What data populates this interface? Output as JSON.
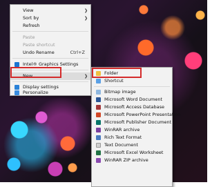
{
  "context_menu": {
    "items": [
      {
        "label": "View"
      },
      {
        "label": "Sort by"
      },
      {
        "label": "Refresh"
      },
      {
        "label": "Paste"
      },
      {
        "label": "Paste shortcut"
      },
      {
        "label": "Undo Rename",
        "shortcut": "Ctrl+Z"
      },
      {
        "label": "Intel® Graphics Settings"
      },
      {
        "label": "New"
      },
      {
        "label": "Display settings"
      },
      {
        "label": "Personalize"
      }
    ]
  },
  "new_submenu": {
    "items": [
      {
        "label": "Folder"
      },
      {
        "label": "Shortcut"
      },
      {
        "label": "Bitmap image"
      },
      {
        "label": "Microsoft Word Document"
      },
      {
        "label": "Microsoft Access Database"
      },
      {
        "label": "Microsoft PowerPoint Presentation"
      },
      {
        "label": "Microsoft Publisher Document"
      },
      {
        "label": "WinRAR archive"
      },
      {
        "label": "Rich Text Format"
      },
      {
        "label": "Text Document"
      },
      {
        "label": "Microsoft Excel Worksheet"
      },
      {
        "label": "WinRAR ZIP archive"
      }
    ]
  },
  "colors": {
    "highlight_border": "#d42a2a",
    "menu_bg": "#f2f2f2",
    "intel_icon": "#1a76d2",
    "folder_icon": "#f0c040",
    "word_icon": "#2b5797",
    "access_icon": "#a4373a",
    "powerpoint_icon": "#d24726",
    "publisher_icon": "#077568",
    "excel_icon": "#217346",
    "winrar_icon": "#7b3fa0"
  }
}
